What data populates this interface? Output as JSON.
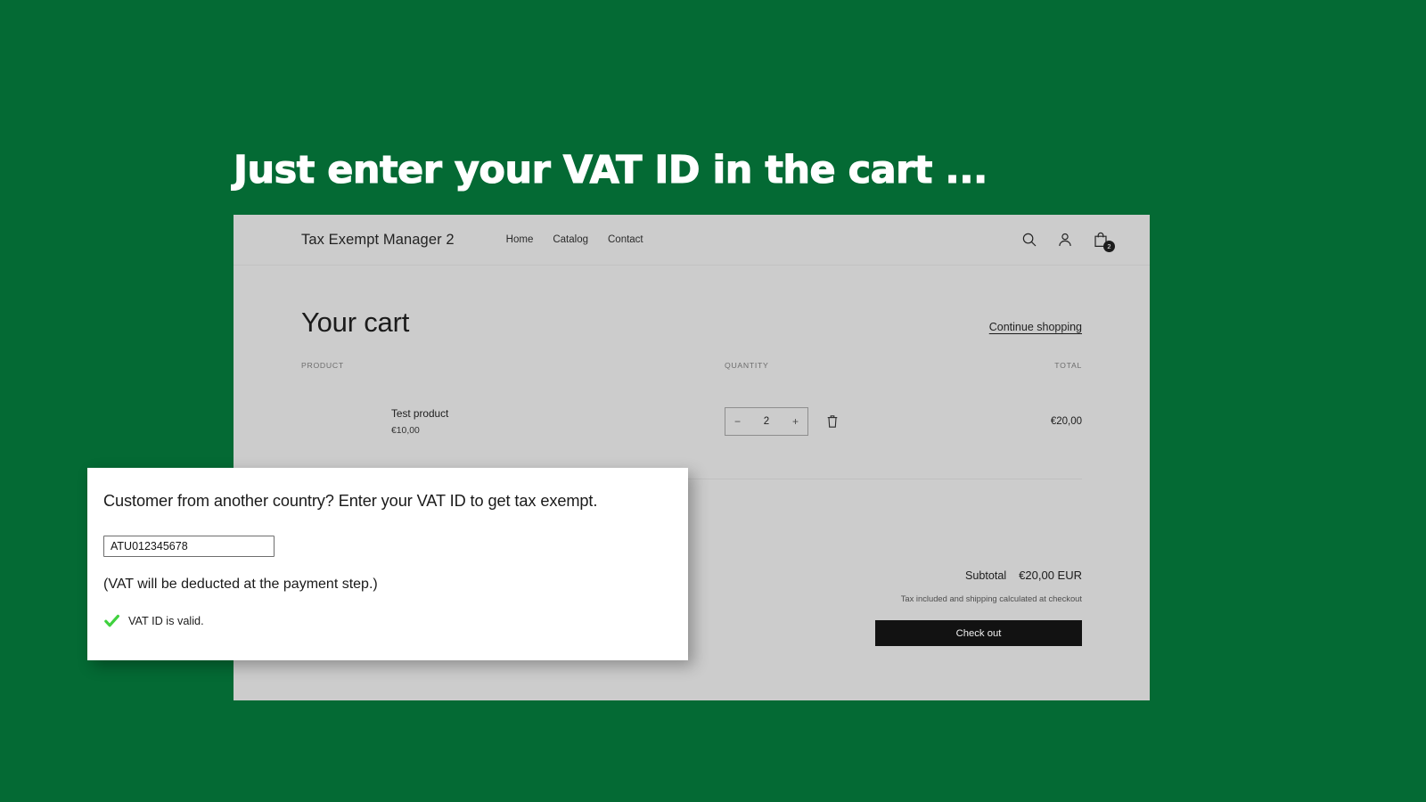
{
  "page": {
    "background_color": "#046A34",
    "headline": "Just enter your VAT ID in the cart ..."
  },
  "storefront": {
    "background_color": "#CCCCCC",
    "header": {
      "brand": "Tax Exempt Manager 2",
      "nav": [
        {
          "label": "Home"
        },
        {
          "label": "Catalog"
        },
        {
          "label": "Contact"
        }
      ],
      "actions": {
        "search_icon": "search-icon",
        "account_icon": "user-icon",
        "cart_icon": "cart-icon",
        "cart_count": "2"
      }
    },
    "cart": {
      "title": "Your cart",
      "continue_shopping": "Continue shopping",
      "columns": {
        "product": "PRODUCT",
        "quantity": "QUANTITY",
        "total": "TOTAL"
      },
      "items": [
        {
          "name": "Test product",
          "price": "€10,00",
          "quantity": "2",
          "decrease_label": "−",
          "increase_label": "+",
          "remove_icon": "trash-icon",
          "line_total": "€20,00"
        }
      ],
      "summary": {
        "subtotal_label": "Subtotal",
        "subtotal_value": "€20,00 EUR",
        "tax_note": "Tax included and shipping calculated at checkout",
        "checkout_label": "Check out"
      }
    }
  },
  "vat_panel": {
    "heading": "Customer from another country? Enter your VAT ID to get tax exempt.",
    "input_value": "ATU012345678",
    "input_placeholder": "VAT ID",
    "note": "(VAT will be deducted at the payment step.)",
    "status_text": "VAT ID is valid.",
    "status_icon": "check-icon",
    "status_color": "#3FD13E"
  }
}
